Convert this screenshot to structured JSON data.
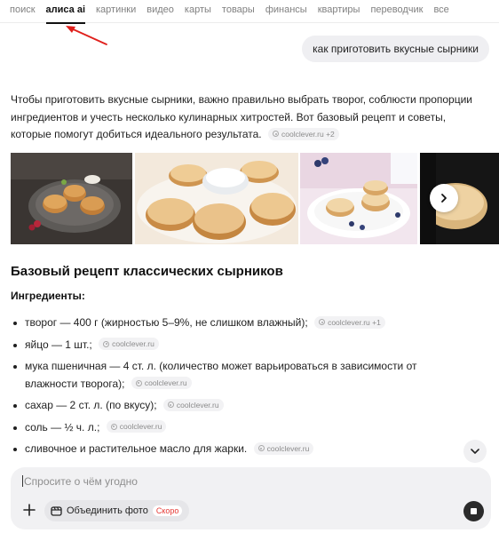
{
  "tabs": [
    {
      "label": "поиск",
      "active": false
    },
    {
      "label": "алиса ai",
      "active": true
    },
    {
      "label": "картинки",
      "active": false
    },
    {
      "label": "видео",
      "active": false
    },
    {
      "label": "карты",
      "active": false
    },
    {
      "label": "товары",
      "active": false
    },
    {
      "label": "финансы",
      "active": false
    },
    {
      "label": "квартиры",
      "active": false
    },
    {
      "label": "переводчик",
      "active": false
    },
    {
      "label": "все",
      "active": false
    }
  ],
  "user_query": "как приготовить вкусные сырники",
  "answer": {
    "intro": "Чтобы приготовить вкусные сырники, важно правильно выбрать творог, соблюсти пропорции ингредиентов и учесть несколько кулинарных хитростей. Вот базовый рецепт и советы, которые помогут добиться идеального результата.",
    "intro_source": "coolclever.ru +2"
  },
  "recipe": {
    "title": "Базовый рецепт классических сырников",
    "ingredients_heading": "Ингредиенты:",
    "items": [
      {
        "text": "творог — 400 г (жирностью 5–9%, не слишком влажный);",
        "source": "coolclever.ru +1"
      },
      {
        "text": "яйцо — 1 шт.;",
        "source": "coolclever.ru"
      },
      {
        "text": "мука пшеничная — 4 ст. л. (количество может варьироваться в зависимости от влажности творога);",
        "source": "coolclever.ru"
      },
      {
        "text": "сахар — 2 ст. л. (по вкусу);",
        "source": "coolclever.ru"
      },
      {
        "text": "соль — ½ ч. л.;",
        "source": "coolclever.ru"
      },
      {
        "text": "сливочное и растительное масло для жарки.",
        "source": "coolclever.ru"
      }
    ]
  },
  "composer": {
    "placeholder": "Спросите о чём угодно",
    "combine_label": "Объединить фото",
    "soon_badge": "Скоро"
  },
  "colors": {
    "accent_red": "#e53935",
    "arrow_red": "#e0201c",
    "composer_bg": "#f1f1f3"
  },
  "icons": [
    "red-arrow-annotation",
    "source-favicon-icon",
    "chevron-right-icon",
    "chevron-down-icon",
    "plus-icon",
    "photo-combine-icon",
    "stop-icon"
  ]
}
